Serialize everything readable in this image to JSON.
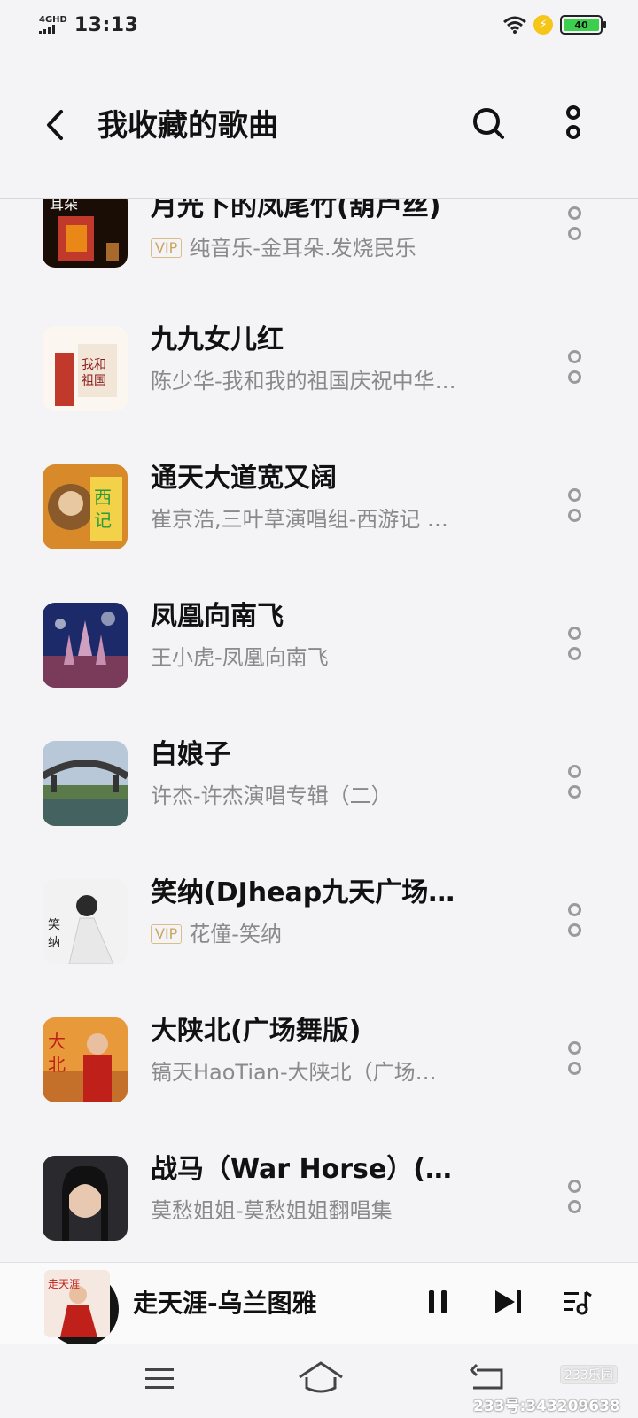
{
  "status_bar": {
    "network": "4GHD",
    "time": "13:13",
    "battery": "40"
  },
  "header": {
    "title": "我收藏的歌曲"
  },
  "songs": [
    {
      "title": "月光下的凤尾竹(葫芦丝)",
      "vip": true,
      "vip_label": "VIP",
      "artist": "纯音乐-金耳朵.发烧民乐"
    },
    {
      "title": "九九女儿红",
      "vip": false,
      "artist": "陈少华-我和我的祖国庆祝中华…"
    },
    {
      "title": "通天大道宽又阔",
      "vip": false,
      "artist": "崔京浩,三叶草演唱组-西游记 …"
    },
    {
      "title": "凤凰向南飞",
      "vip": false,
      "artist": "王小虎-凤凰向南飞"
    },
    {
      "title": "白娘子",
      "vip": false,
      "artist": "许杰-许杰演唱专辑（二）"
    },
    {
      "title": "笑纳(DJheap九天广场…",
      "vip": true,
      "vip_label": "VIP",
      "artist": "花僮-笑纳"
    },
    {
      "title": "大陕北(广场舞版)",
      "vip": false,
      "artist": "镐天HaoTian-大陕北（广场…"
    },
    {
      "title": "战马（War Horse）(…",
      "vip": false,
      "artist": "莫愁姐姐-莫愁姐姐翻唱集"
    }
  ],
  "player": {
    "now_playing": "走天涯-乌兰图雅",
    "cover_text": "走天涯"
  },
  "watermark": {
    "logo": "233乐园",
    "id_text": "233号:343209638"
  },
  "colors": {
    "background": "#f4f4f6",
    "vip_gold": "#c9a460",
    "subtitle_gray": "#8a8a8e"
  }
}
